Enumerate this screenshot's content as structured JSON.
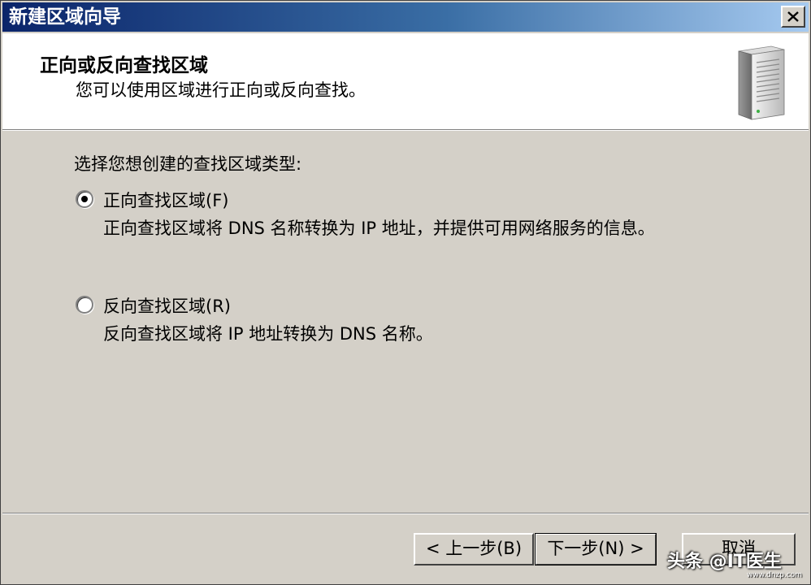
{
  "window": {
    "title": "新建区域向导",
    "close_glyph": "✕"
  },
  "header": {
    "title": "正向或反向查找区域",
    "subtitle": "您可以使用区域进行正向或反向查找。",
    "icon": "server-icon"
  },
  "body": {
    "prompt": "选择您想创建的查找区域类型:",
    "options": [
      {
        "label": "正向查找区域(F)",
        "description": "正向查找区域将 DNS 名称转换为 IP 地址，并提供可用网络服务的信息。",
        "selected": true
      },
      {
        "label": "反向查找区域(R)",
        "description": "反向查找区域将 IP 地址转换为 DNS 名称。",
        "selected": false
      }
    ]
  },
  "buttons": {
    "back": "< 上一步(B)",
    "next": "下一步(N) >",
    "cancel": "取消"
  },
  "watermark": {
    "text": "头条 @IT医生",
    "url": "www.dnzp.com"
  }
}
